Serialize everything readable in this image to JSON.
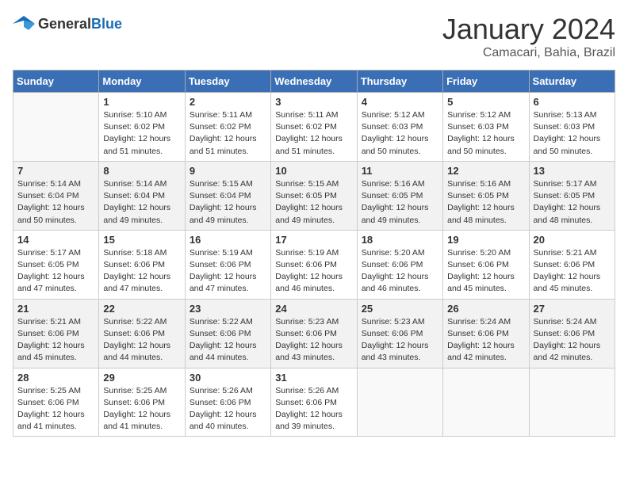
{
  "logo": {
    "general": "General",
    "blue": "Blue"
  },
  "header": {
    "month": "January 2024",
    "location": "Camacari, Bahia, Brazil"
  },
  "days_of_week": [
    "Sunday",
    "Monday",
    "Tuesday",
    "Wednesday",
    "Thursday",
    "Friday",
    "Saturday"
  ],
  "weeks": [
    [
      {
        "day": "",
        "info": ""
      },
      {
        "day": "1",
        "info": "Sunrise: 5:10 AM\nSunset: 6:02 PM\nDaylight: 12 hours\nand 51 minutes."
      },
      {
        "day": "2",
        "info": "Sunrise: 5:11 AM\nSunset: 6:02 PM\nDaylight: 12 hours\nand 51 minutes."
      },
      {
        "day": "3",
        "info": "Sunrise: 5:11 AM\nSunset: 6:02 PM\nDaylight: 12 hours\nand 51 minutes."
      },
      {
        "day": "4",
        "info": "Sunrise: 5:12 AM\nSunset: 6:03 PM\nDaylight: 12 hours\nand 50 minutes."
      },
      {
        "day": "5",
        "info": "Sunrise: 5:12 AM\nSunset: 6:03 PM\nDaylight: 12 hours\nand 50 minutes."
      },
      {
        "day": "6",
        "info": "Sunrise: 5:13 AM\nSunset: 6:03 PM\nDaylight: 12 hours\nand 50 minutes."
      }
    ],
    [
      {
        "day": "7",
        "info": "Sunrise: 5:14 AM\nSunset: 6:04 PM\nDaylight: 12 hours\nand 50 minutes."
      },
      {
        "day": "8",
        "info": "Sunrise: 5:14 AM\nSunset: 6:04 PM\nDaylight: 12 hours\nand 49 minutes."
      },
      {
        "day": "9",
        "info": "Sunrise: 5:15 AM\nSunset: 6:04 PM\nDaylight: 12 hours\nand 49 minutes."
      },
      {
        "day": "10",
        "info": "Sunrise: 5:15 AM\nSunset: 6:05 PM\nDaylight: 12 hours\nand 49 minutes."
      },
      {
        "day": "11",
        "info": "Sunrise: 5:16 AM\nSunset: 6:05 PM\nDaylight: 12 hours\nand 49 minutes."
      },
      {
        "day": "12",
        "info": "Sunrise: 5:16 AM\nSunset: 6:05 PM\nDaylight: 12 hours\nand 48 minutes."
      },
      {
        "day": "13",
        "info": "Sunrise: 5:17 AM\nSunset: 6:05 PM\nDaylight: 12 hours\nand 48 minutes."
      }
    ],
    [
      {
        "day": "14",
        "info": "Sunrise: 5:17 AM\nSunset: 6:05 PM\nDaylight: 12 hours\nand 47 minutes."
      },
      {
        "day": "15",
        "info": "Sunrise: 5:18 AM\nSunset: 6:06 PM\nDaylight: 12 hours\nand 47 minutes."
      },
      {
        "day": "16",
        "info": "Sunrise: 5:19 AM\nSunset: 6:06 PM\nDaylight: 12 hours\nand 47 minutes."
      },
      {
        "day": "17",
        "info": "Sunrise: 5:19 AM\nSunset: 6:06 PM\nDaylight: 12 hours\nand 46 minutes."
      },
      {
        "day": "18",
        "info": "Sunrise: 5:20 AM\nSunset: 6:06 PM\nDaylight: 12 hours\nand 46 minutes."
      },
      {
        "day": "19",
        "info": "Sunrise: 5:20 AM\nSunset: 6:06 PM\nDaylight: 12 hours\nand 45 minutes."
      },
      {
        "day": "20",
        "info": "Sunrise: 5:21 AM\nSunset: 6:06 PM\nDaylight: 12 hours\nand 45 minutes."
      }
    ],
    [
      {
        "day": "21",
        "info": "Sunrise: 5:21 AM\nSunset: 6:06 PM\nDaylight: 12 hours\nand 45 minutes."
      },
      {
        "day": "22",
        "info": "Sunrise: 5:22 AM\nSunset: 6:06 PM\nDaylight: 12 hours\nand 44 minutes."
      },
      {
        "day": "23",
        "info": "Sunrise: 5:22 AM\nSunset: 6:06 PM\nDaylight: 12 hours\nand 44 minutes."
      },
      {
        "day": "24",
        "info": "Sunrise: 5:23 AM\nSunset: 6:06 PM\nDaylight: 12 hours\nand 43 minutes."
      },
      {
        "day": "25",
        "info": "Sunrise: 5:23 AM\nSunset: 6:06 PM\nDaylight: 12 hours\nand 43 minutes."
      },
      {
        "day": "26",
        "info": "Sunrise: 5:24 AM\nSunset: 6:06 PM\nDaylight: 12 hours\nand 42 minutes."
      },
      {
        "day": "27",
        "info": "Sunrise: 5:24 AM\nSunset: 6:06 PM\nDaylight: 12 hours\nand 42 minutes."
      }
    ],
    [
      {
        "day": "28",
        "info": "Sunrise: 5:25 AM\nSunset: 6:06 PM\nDaylight: 12 hours\nand 41 minutes."
      },
      {
        "day": "29",
        "info": "Sunrise: 5:25 AM\nSunset: 6:06 PM\nDaylight: 12 hours\nand 41 minutes."
      },
      {
        "day": "30",
        "info": "Sunrise: 5:26 AM\nSunset: 6:06 PM\nDaylight: 12 hours\nand 40 minutes."
      },
      {
        "day": "31",
        "info": "Sunrise: 5:26 AM\nSunset: 6:06 PM\nDaylight: 12 hours\nand 39 minutes."
      },
      {
        "day": "",
        "info": ""
      },
      {
        "day": "",
        "info": ""
      },
      {
        "day": "",
        "info": ""
      }
    ]
  ]
}
